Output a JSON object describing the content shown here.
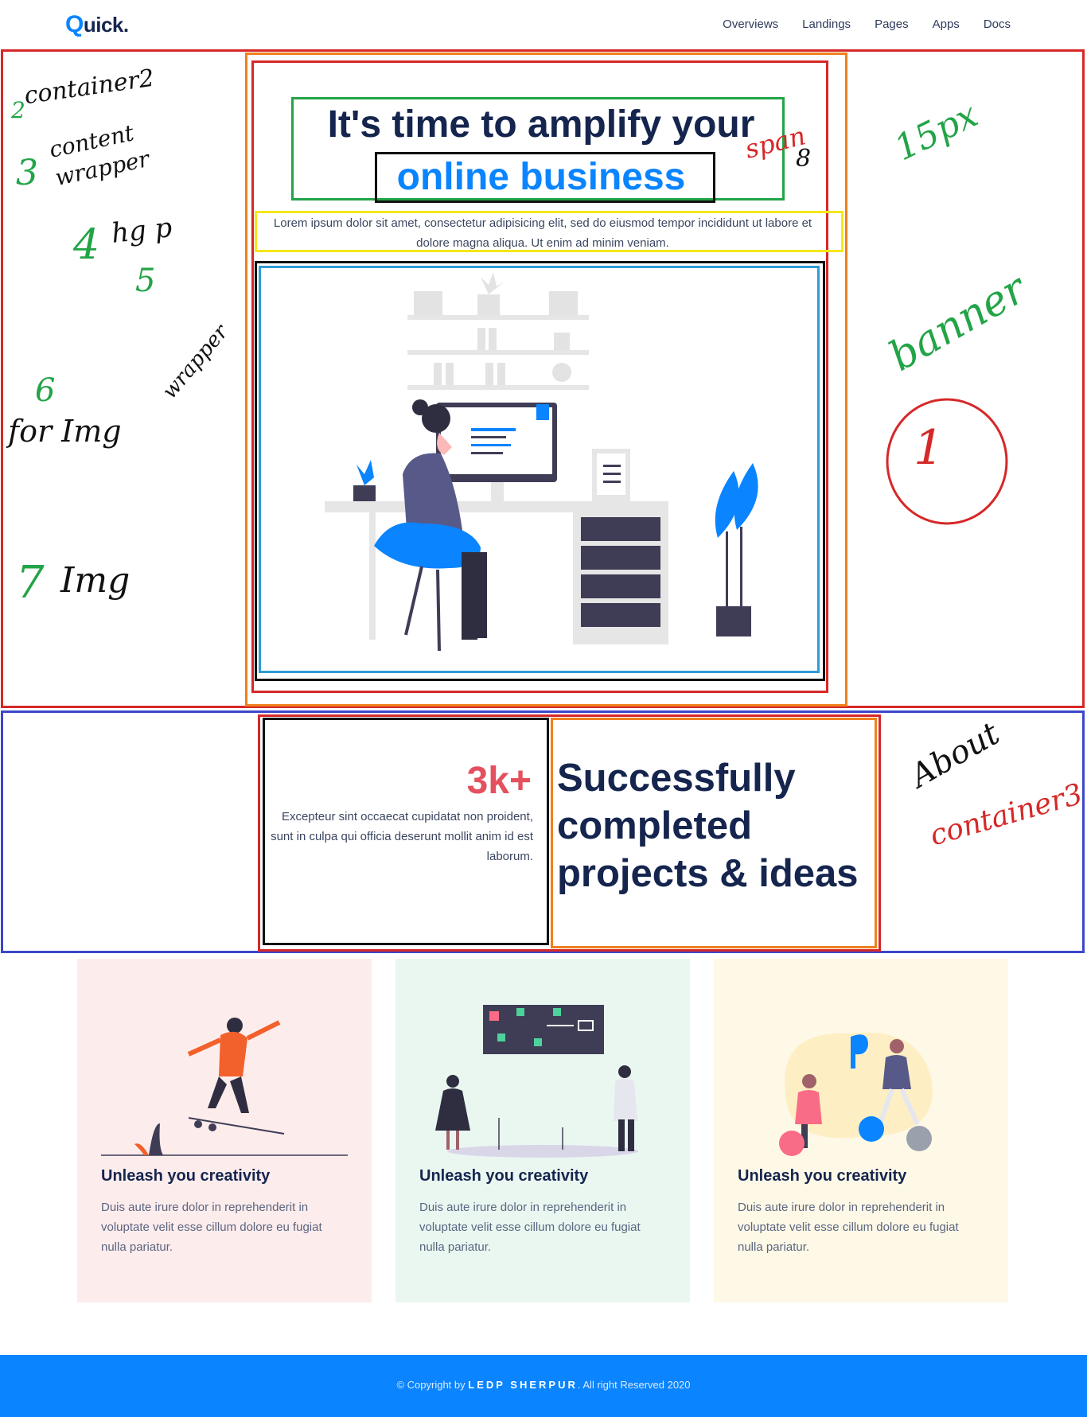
{
  "nav": {
    "logo_letter": "Q",
    "logo_rest": "uick.",
    "links": [
      "Overviews",
      "Landings",
      "Pages",
      "Apps",
      "Docs"
    ]
  },
  "hero": {
    "title_line1": "It's time to amplify your",
    "title_accent": "online business",
    "lead": "Lorem ipsum dolor sit amet, consectetur adipisicing elit, sed do eiusmod tempor incididunt ut labore et dolore magna aliqua. Ut enim ad minim veniam."
  },
  "about": {
    "stat": "3k+",
    "stat_text": "Excepteur sint occaecat cupidatat non proident, sunt in culpa qui officia deserunt mollit anim id est laborum.",
    "title": "Successfully completed projects & ideas"
  },
  "cards": [
    {
      "title": "Unleash you creativity",
      "text": "Duis aute irure dolor in reprehenderit in voluptate velit esse cillum dolore eu fugiat nulla pariatur.",
      "bg": "#fdecec"
    },
    {
      "title": "Unleash you creativity",
      "text": "Duis aute irure dolor in reprehenderit in voluptate velit esse cillum dolore eu fugiat nulla pariatur.",
      "bg": "#eaf7f1"
    },
    {
      "title": "Unleash you creativity",
      "text": "Duis aute irure dolor in reprehenderit in voluptate velit esse cillum dolore eu fugiat nulla pariatur.",
      "bg": "#fef8e7"
    }
  ],
  "annotations": {
    "container2": "container2",
    "n2": "2",
    "content_wrapper": "content wrapper",
    "n3": "3",
    "hgp": "hg p",
    "n4": "4",
    "n5": "5",
    "for_img_wrapper_a": "for Img",
    "for_img_wrapper_b": "wrapper",
    "n6": "6",
    "img": "Img",
    "n7": "7",
    "span": "span",
    "n8": "8",
    "px15": "15px",
    "banner": "banner",
    "one": "1",
    "about": "About",
    "container3": "container3"
  },
  "footer": {
    "prefix": "© Copyright by ",
    "brand": "LEDP SHERPUR",
    "suffix": ". All right Reserved 2020"
  },
  "colors": {
    "primary": "#0a84ff",
    "navy": "#15254e",
    "stat_red": "#e4505e",
    "annot_red": "#d62828",
    "annot_orange": "#f07f1e",
    "annot_green": "#22a447",
    "annot_yellow": "#f7e61a",
    "annot_blue": "#2f9bd6",
    "annot_purple": "#3b47c9"
  }
}
